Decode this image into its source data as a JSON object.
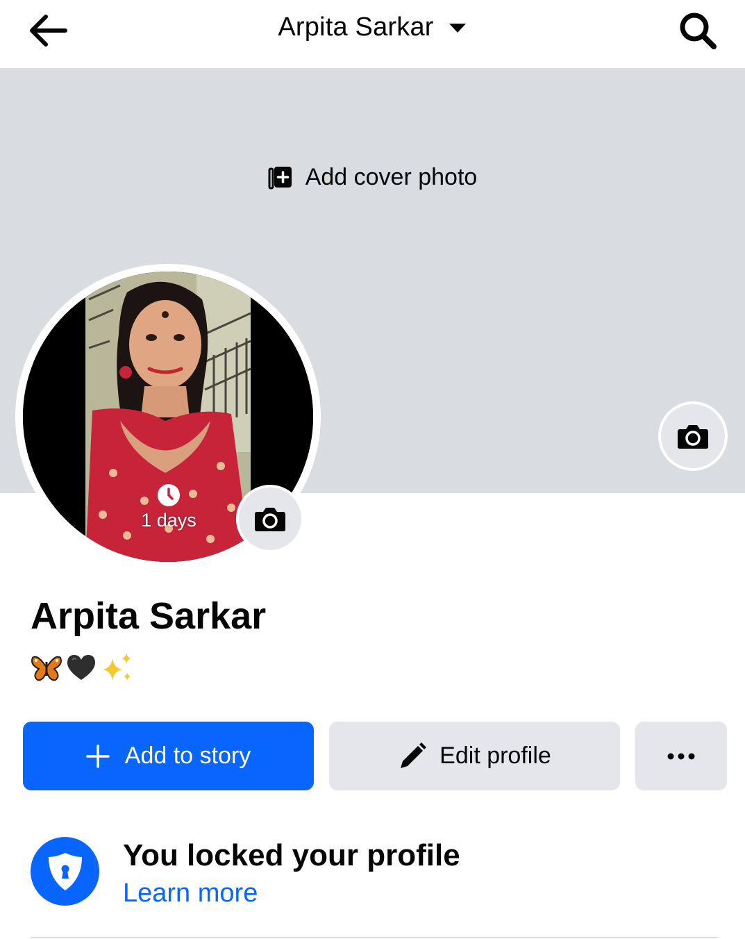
{
  "header": {
    "title": "Arpita Sarkar",
    "back_icon": "arrow-left-icon",
    "dropdown_icon": "caret-down-icon",
    "search_icon": "search-icon"
  },
  "cover": {
    "add_cover_label": "Add cover photo",
    "add_icon": "add-photo-icon",
    "camera_icon": "camera-icon"
  },
  "avatar": {
    "story_label": "1 days",
    "story_icon": "clock-icon",
    "camera_icon": "camera-icon"
  },
  "profile": {
    "name": "Arpita Sarkar",
    "bio_emojis": [
      "butterfly",
      "black-heart",
      "sparkles"
    ]
  },
  "actions": {
    "add_story_label": "Add to story",
    "edit_profile_label": "Edit profile",
    "more_icon": "more-dots-icon"
  },
  "lock_notice": {
    "title": "You locked your profile",
    "link": "Learn more",
    "icon": "shield-lock-icon"
  },
  "colors": {
    "accent": "#0866ff",
    "cover_bg": "#d9dce1",
    "button_gray": "#e4e6eb"
  }
}
